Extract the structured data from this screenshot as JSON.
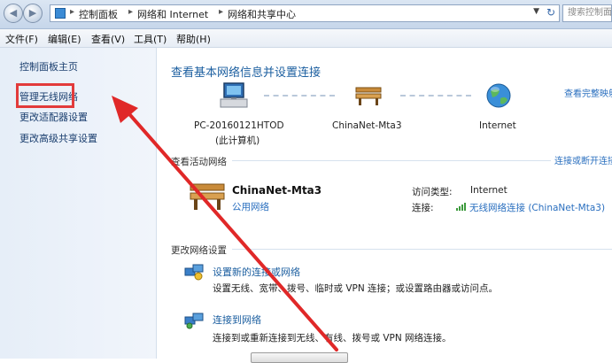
{
  "address_bar": {
    "crumbs": [
      "控制面板",
      "网络和 Internet",
      "网络和共享中心"
    ],
    "search_placeholder": "搜索控制面板"
  },
  "menu": [
    "文件(F)",
    "编辑(E)",
    "查看(V)",
    "工具(T)",
    "帮助(H)"
  ],
  "sidebar": {
    "items": [
      "控制面板主页",
      "管理无线网络",
      "更改适配器设置",
      "更改高级共享设置"
    ]
  },
  "main": {
    "title": "查看基本网络信息并设置连接",
    "see_full_map": "查看完整映射",
    "map": {
      "computer_name": "PC-20160121HTOD",
      "computer_sub": "(此计算机)",
      "network_name": "ChinaNet-Mta3",
      "internet": "Internet"
    },
    "active_section": {
      "heading": "查看活动网络",
      "connect_link": "连接或断开连接",
      "network_name": "ChinaNet-Mta3",
      "network_type": "公用网络",
      "access_label": "访问类型:",
      "access_value": "Internet",
      "connection_label": "连接:",
      "connection_value": "无线网络连接 (ChinaNet-Mta3)"
    },
    "change_section": {
      "heading": "更改网络设置",
      "tasks": [
        {
          "title": "设置新的连接或网络",
          "desc": "设置无线、宽带、拨号、临时或 VPN 连接；或设置路由器或访问点。"
        },
        {
          "title": "连接到网络",
          "desc": "连接到或重新连接到无线、有线、拨号或 VPN 网络连接。"
        }
      ]
    }
  },
  "annotation": {
    "highlight_color": "#e23b3b",
    "arrow_color": "#e02828"
  }
}
